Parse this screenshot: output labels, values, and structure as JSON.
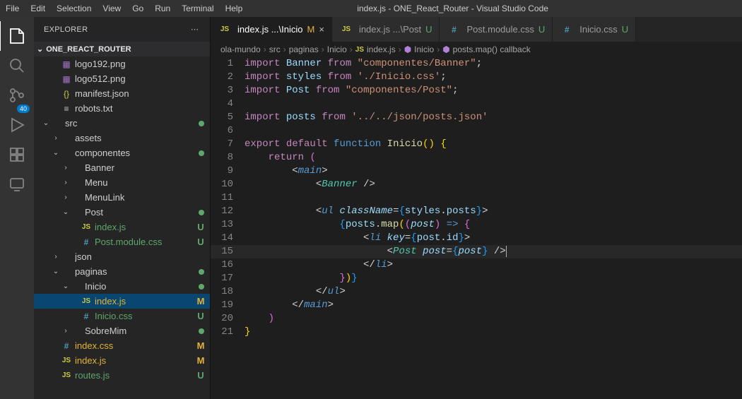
{
  "window_title": "index.js - ONE_React_Router - Visual Studio Code",
  "menubar": [
    "File",
    "Edit",
    "Selection",
    "View",
    "Go",
    "Run",
    "Terminal",
    "Help"
  ],
  "sidebar": {
    "title": "EXPLORER",
    "project": "ONE_REACT_ROUTER",
    "search_placeholder": "Search",
    "badge": "40",
    "tree": [
      {
        "depth": 1,
        "arrow": "",
        "icon": "img",
        "label": "logo192.png",
        "mod": ""
      },
      {
        "depth": 1,
        "arrow": "",
        "icon": "img",
        "label": "logo512.png",
        "mod": ""
      },
      {
        "depth": 1,
        "arrow": "",
        "icon": "json",
        "label": "manifest.json",
        "mod": ""
      },
      {
        "depth": 1,
        "arrow": "",
        "icon": "txt",
        "label": "robots.txt",
        "mod": ""
      },
      {
        "depth": 0,
        "arrow": "v",
        "icon": "",
        "label": "src",
        "mod": "dot"
      },
      {
        "depth": 1,
        "arrow": ">",
        "icon": "",
        "label": "assets",
        "mod": ""
      },
      {
        "depth": 1,
        "arrow": "v",
        "icon": "",
        "label": "componentes",
        "mod": "dot"
      },
      {
        "depth": 2,
        "arrow": ">",
        "icon": "",
        "label": "Banner",
        "mod": ""
      },
      {
        "depth": 2,
        "arrow": ">",
        "icon": "",
        "label": "Menu",
        "mod": ""
      },
      {
        "depth": 2,
        "arrow": ">",
        "icon": "",
        "label": "MenuLink",
        "mod": ""
      },
      {
        "depth": 2,
        "arrow": "v",
        "icon": "",
        "label": "Post",
        "mod": "dot"
      },
      {
        "depth": 3,
        "arrow": "",
        "icon": "js",
        "label": "index.js",
        "mod": "U"
      },
      {
        "depth": 3,
        "arrow": "",
        "icon": "css",
        "label": "Post.module.css",
        "mod": "U"
      },
      {
        "depth": 1,
        "arrow": ">",
        "icon": "",
        "label": "json",
        "mod": ""
      },
      {
        "depth": 1,
        "arrow": "v",
        "icon": "",
        "label": "paginas",
        "mod": "dot"
      },
      {
        "depth": 2,
        "arrow": "v",
        "icon": "",
        "label": "Inicio",
        "mod": "dot"
      },
      {
        "depth": 3,
        "arrow": "",
        "icon": "js",
        "label": "index.js",
        "mod": "M",
        "selected": true
      },
      {
        "depth": 3,
        "arrow": "",
        "icon": "css",
        "label": "Inicio.css",
        "mod": "U"
      },
      {
        "depth": 2,
        "arrow": ">",
        "icon": "",
        "label": "SobreMim",
        "mod": "dot"
      },
      {
        "depth": 1,
        "arrow": "",
        "icon": "css",
        "label": "index.css",
        "mod": "M"
      },
      {
        "depth": 1,
        "arrow": "",
        "icon": "js",
        "label": "index.js",
        "mod": "M"
      },
      {
        "depth": 1,
        "arrow": "",
        "icon": "js",
        "label": "routes.js",
        "mod": "U"
      }
    ]
  },
  "tabs": [
    {
      "icon": "js",
      "label": "index.js ...\\Inicio",
      "status": "M",
      "active": true,
      "close": true
    },
    {
      "icon": "js",
      "label": "index.js ...\\Post",
      "status": "U",
      "active": false
    },
    {
      "icon": "css",
      "label": "Post.module.css",
      "status": "U",
      "active": false
    },
    {
      "icon": "css",
      "label": "Inicio.css",
      "status": "U",
      "active": false
    }
  ],
  "breadcrumbs": [
    "ola-mundo",
    "src",
    "paginas",
    "Inicio",
    "index.js",
    "Inicio",
    "posts.map() callback"
  ],
  "code_lines": [
    {
      "n": 1,
      "html": "<span class='k-import'>import</span> <span class='name'>Banner</span> <span class='k-from'>from</span> <span class='str'>\"componentes/Banner\"</span>;"
    },
    {
      "n": 2,
      "html": "<span class='k-import'>import</span> <span class='name'>styles</span> <span class='k-from'>from</span> <span class='str'>'./Inicio.css'</span>;"
    },
    {
      "n": 3,
      "html": "<span class='k-import'>import</span> <span class='name'>Post</span> <span class='k-from'>from</span> <span class='str'>\"componentes/Post\"</span>;"
    },
    {
      "n": 4,
      "html": ""
    },
    {
      "n": 5,
      "html": "<span class='k-import'>import</span> <span class='name'>posts</span> <span class='k-from'>from</span> <span class='str'>'../../json/posts.json'</span>"
    },
    {
      "n": 6,
      "html": ""
    },
    {
      "n": 7,
      "html": "<span class='k-export'>export</span> <span class='k-default'>default</span> <span class='k-function'>function</span> <span class='fnname'>Inicio</span><span class='brace'>(</span><span class='brace'>)</span> <span class='brace'>{</span>"
    },
    {
      "n": 8,
      "html": "    <span class='k-return'>return</span> <span class='brace2'>(</span>"
    },
    {
      "n": 9,
      "html": "        <span class='punct'>&lt;</span><span class='htmltag'>main</span><span class='punct'>&gt;</span>"
    },
    {
      "n": 10,
      "html": "            <span class='punct'>&lt;</span><span class='tag'>Banner</span> <span class='punct'>/&gt;</span>"
    },
    {
      "n": 11,
      "html": ""
    },
    {
      "n": 12,
      "html": "            <span class='punct'>&lt;</span><span class='htmltag'>ul</span> <span class='attr'>className</span><span class='punct'>=</span><span class='brace3'>{</span><span class='name'>styles</span><span class='punct'>.</span><span class='name'>posts</span><span class='brace3'>}</span><span class='punct'>&gt;</span>"
    },
    {
      "n": 13,
      "html": "                <span class='brace3'>{</span><span class='name'>posts</span><span class='punct'>.</span><span class='fnname'>map</span><span class='brace'>(</span><span class='brace2'>(</span><span class='param'>post</span><span class='brace2'>)</span> <span class='k-function'>=&gt;</span> <span class='brace2'>{</span>"
    },
    {
      "n": 14,
      "html": "                    <span class='punct'>&lt;</span><span class='htmltag'>li</span> <span class='attr'>key</span><span class='punct'>=</span><span class='brace3'>{</span><span class='name'>post</span><span class='punct'>.</span><span class='name'>id</span><span class='brace3'>}</span><span class='punct'>&gt;</span>"
    },
    {
      "n": 15,
      "html": "                        <span class='punct'>&lt;</span><span class='tag'>Post</span> <span class='attr'>post</span><span class='punct'>=</span><span class='brace3'>{</span><span class='param'>post</span><span class='brace3'>}</span> <span class='punct'>/&gt;</span><span class='cursor'></span>",
      "hl": true
    },
    {
      "n": 16,
      "html": "                    <span class='punct'>&lt;/</span><span class='htmltag'>li</span><span class='punct'>&gt;</span>"
    },
    {
      "n": 17,
      "html": "                <span class='brace2'>}</span><span class='brace'>)</span><span class='brace3'>}</span>"
    },
    {
      "n": 18,
      "html": "            <span class='punct'>&lt;/</span><span class='htmltag'>ul</span><span class='punct'>&gt;</span>"
    },
    {
      "n": 19,
      "html": "        <span class='punct'>&lt;/</span><span class='htmltag'>main</span><span class='punct'>&gt;</span>"
    },
    {
      "n": 20,
      "html": "    <span class='brace2'>)</span>"
    },
    {
      "n": 21,
      "html": "<span class='brace'>}</span>"
    }
  ]
}
